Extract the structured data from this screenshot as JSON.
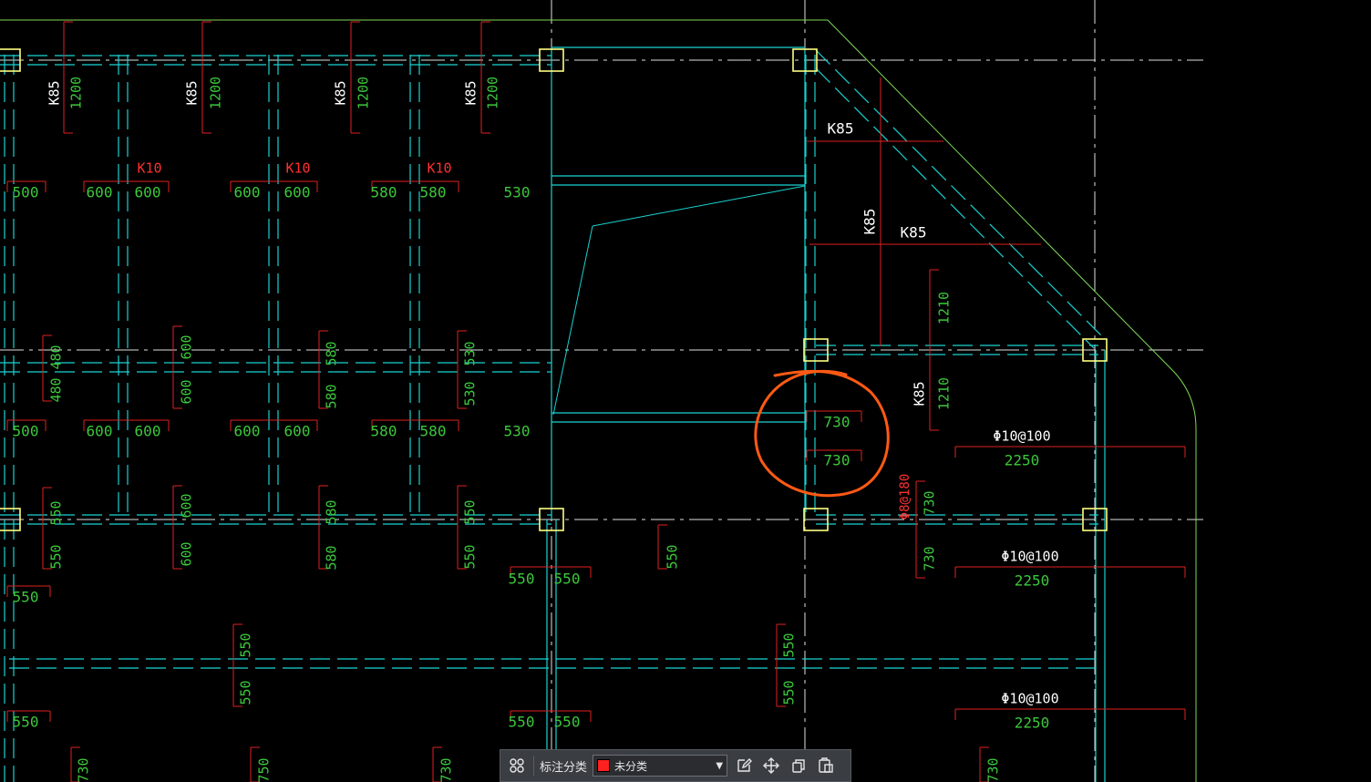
{
  "colors": {
    "background": "#000000",
    "beam": "#19d2d2",
    "axis": "#e0e0e0",
    "dim_line": "#e02020",
    "dim_text": "#3cc83c",
    "mark_text": "#ffffff",
    "red_text": "#ff3030",
    "column": "#ffff80",
    "boundary": "#7ed957",
    "highlight": "#ff5a14"
  },
  "annotations": {
    "k85_1": "K85",
    "k85_2": "K85",
    "k85_3": "K85",
    "k85_4": "K85",
    "d1200_1": "1200",
    "d1200_2": "1200",
    "d1200_3": "1200",
    "d1200_4": "1200",
    "k10_1": "K10",
    "k10_2": "K10",
    "k10_3": "K10",
    "r1_a": "500",
    "r1_b": "600",
    "r1_c": "600",
    "r1_d": "600",
    "r1_e": "600",
    "r1_f": "580",
    "r1_g": "580",
    "r1_h": "530",
    "v1_a": "480",
    "v1_b": "480",
    "v1_c": "600",
    "v1_d": "600",
    "v1_e": "580",
    "v1_f": "580",
    "v1_g": "530",
    "v1_h": "530",
    "r2_a": "500",
    "r2_b": "600",
    "r2_c": "600",
    "r2_d": "600",
    "r2_e": "600",
    "r2_f": "580",
    "r2_g": "580",
    "r2_h": "530",
    "v2_a": "550",
    "v2_b": "550",
    "v2_c": "600",
    "v2_d": "600",
    "v2_e": "580",
    "v2_f": "580",
    "v2_g": "550",
    "v2_h": "550",
    "v2_i": "550",
    "r3_a": "550",
    "r3_b": "550",
    "l_550_a": "550",
    "l_550_b": "550",
    "v3_a": "550",
    "v3_b": "550",
    "v3_c": "550",
    "v3_d": "550",
    "r4_a": "550",
    "r4_b": "550",
    "b_730_a": "730",
    "b_750": "750",
    "b_730_b": "730",
    "b_730_c": "730",
    "k85_diag": "K85",
    "k85_v": "K85",
    "k85_h": "K85",
    "k85_r": "K85",
    "d1210_a": "1210",
    "d1210_b": "1210",
    "c730_a": "730",
    "c730_b": "730",
    "phi_a": "Φ10@100",
    "n2250_a": "2250",
    "phi_b": "Φ10@100",
    "n2250_b": "2250",
    "phi_c": "Φ10@100",
    "n2250_c": "2250",
    "red_phi8": "Φ8@180",
    "r730_a": "730",
    "r730_b": "730"
  },
  "toolbar": {
    "label": "标注分类",
    "select_value": "未分类",
    "select_color": "#ff2020",
    "icons": [
      "grid-icon",
      "edit-icon",
      "move-icon",
      "copy-icon",
      "paste-icon"
    ]
  }
}
